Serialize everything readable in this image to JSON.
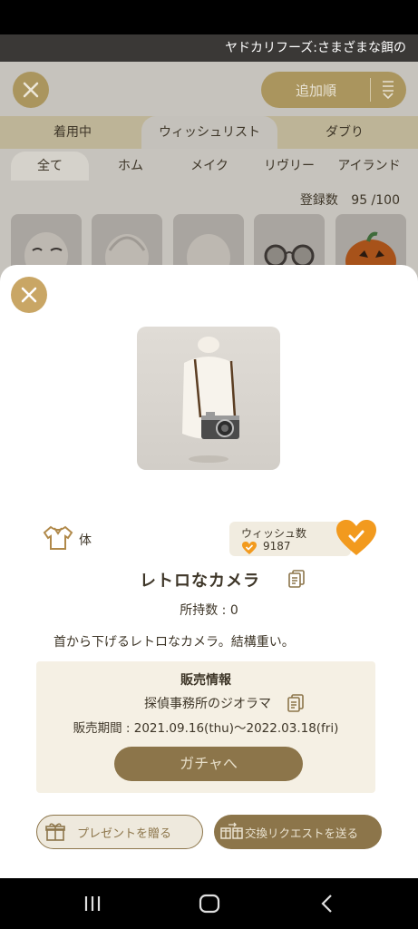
{
  "app": {
    "ticker": "ヤドカリフーズ:さまざまな餌の",
    "sort_label": "追加順",
    "tabs": [
      {
        "label": "着用中"
      },
      {
        "label": "ウィッシュリスト"
      },
      {
        "label": "ダブり"
      }
    ],
    "filters": [
      {
        "label": "全て"
      },
      {
        "label": "ホム"
      },
      {
        "label": "メイク"
      },
      {
        "label": "リヴリー"
      },
      {
        "label": "アイランド"
      }
    ],
    "registered_label": "登録数",
    "registered_value": "95 /100"
  },
  "detail": {
    "category_icon": "shirt-icon",
    "category": "体",
    "wish_label": "ウィッシュ数",
    "wish_count": "9187",
    "name": "レトロなカメラ",
    "owned": "所持数 : 0",
    "description": "首から下げるレトロなカメラ。結構重い。",
    "sale": {
      "title": "販売情報",
      "source": "探偵事務所のジオラマ",
      "period": "販売期間 : 2021.09.16(thu)〜2022.03.18(fri)",
      "gacha_button": "ガチャへ"
    },
    "present_button": "プレゼントを贈る",
    "trade_button": "交換リクエストを送る"
  },
  "colors": {
    "gold": "#c9a665",
    "brown": "#8c754a",
    "heart": "#f29a1e",
    "text": "#3e3628"
  }
}
